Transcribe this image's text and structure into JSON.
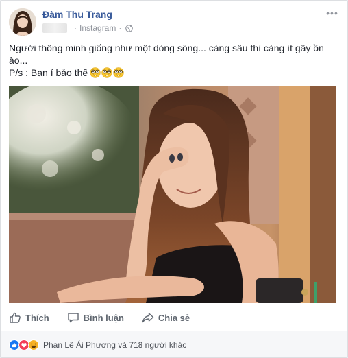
{
  "post": {
    "author": "Đàm Thu Trang",
    "source": "Instagram",
    "separator": "·",
    "more_label": "•••",
    "text_line1": "Người thông minh giống như một dòng sông... càng sâu thì càng ít gây ồn ào...",
    "text_line2": "P/s : Bạn í bảo thế"
  },
  "actions": {
    "like": "Thích",
    "comment": "Bình luận",
    "share": "Chia sẻ"
  },
  "reactions": {
    "summary": "Phan Lê Ái Phương và 718 người khác",
    "colors": {
      "like": "#1877f2",
      "love": "#f33e58",
      "haha": "#f7b125"
    }
  },
  "colors": {
    "author_link": "#365899",
    "meta": "#90949c",
    "action": "#606770"
  },
  "icons": {
    "globe": "globe-icon",
    "more": "more-options-icon",
    "like": "thumbs-up-icon",
    "comment": "comment-icon",
    "share": "share-arrow-icon",
    "emoji": "nerd-face-emoji"
  }
}
